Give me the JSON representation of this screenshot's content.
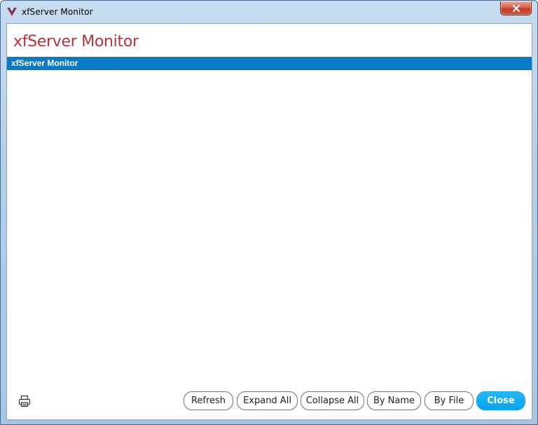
{
  "window": {
    "title": "xfServer Monitor",
    "icon": "xfserver-app-icon",
    "close_icon": "close-icon"
  },
  "dialog": {
    "heading": "xfServer Monitor",
    "heading_color": "#b7323a"
  },
  "tree": {
    "items": [
      {
        "label": "xfServer Monitor",
        "selected": true
      }
    ],
    "selection_color": "#0a7ac6"
  },
  "footer": {
    "print_icon": "printer-icon",
    "buttons": {
      "refresh": "Refresh",
      "expand_all": "Expand All",
      "collapse_all": "Collapse All",
      "by_name": "By Name",
      "by_file": "By File",
      "close": "Close"
    },
    "primary_color": "#09a3ee"
  }
}
